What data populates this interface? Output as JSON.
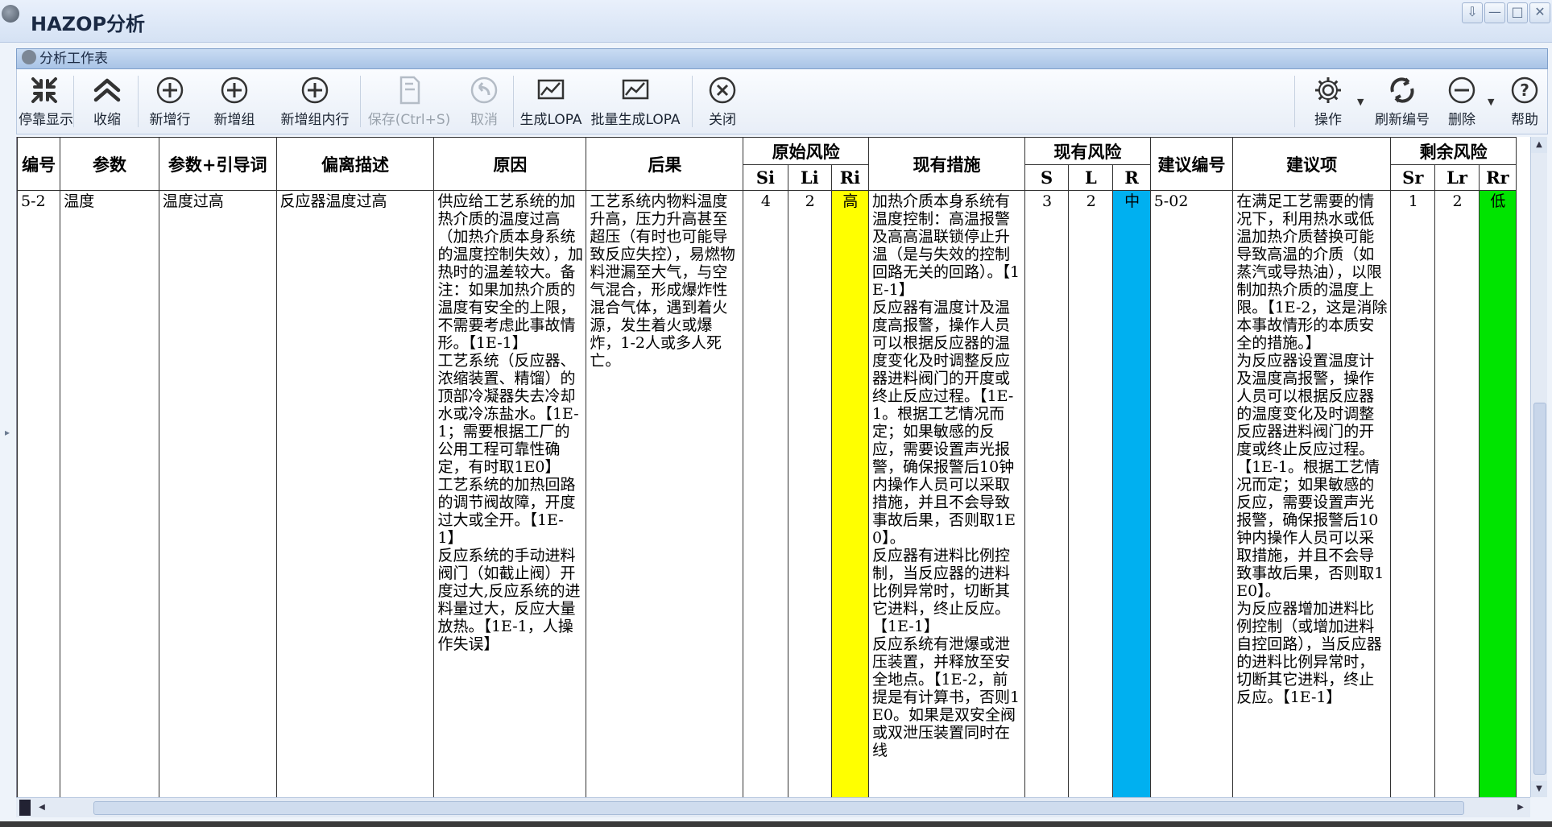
{
  "window": {
    "title": "HAZOP分析",
    "min_label": "—",
    "max_label": "□",
    "close_label": "✕",
    "pin_label": "⇩"
  },
  "panel": {
    "title": "分析工作表"
  },
  "toolbar": {
    "dock": "停靠显示",
    "collapse": "收缩",
    "add_row": "新增行",
    "add_group": "新增组",
    "add_in_group": "新增组内行",
    "save": "保存(Ctrl+S)",
    "cancel": "取消",
    "gen_lopa": "生成LOPA",
    "batch_lopa": "批量生成LOPA",
    "close": "关闭",
    "operate": "操作",
    "renumber": "刷新编号",
    "delete": "删除",
    "help": "帮助"
  },
  "table": {
    "headers": {
      "id": "编号",
      "param": "参数",
      "param_guide": "参数+引导词",
      "deviation": "偏离描述",
      "cause": "原因",
      "consequence": "后果",
      "orig_risk": "原始风险",
      "si": "Si",
      "li": "Li",
      "ri": "Ri",
      "measures": "现有措施",
      "cur_risk": "现有风险",
      "s": "S",
      "l": "L",
      "r": "R",
      "rec_no": "建议编号",
      "recommendation": "建议项",
      "res_risk": "剩余风险",
      "sr": "Sr",
      "lr": "Lr",
      "rr": "Rr"
    },
    "row": {
      "id": "5-2",
      "param": "温度",
      "param_guide": "温度过高",
      "deviation": "反应器温度过高",
      "cause": "供应给工艺系统的加热介质的温度过高（加热介质本身系统的温度控制失效），加热时的温差较大。备注：如果加热介质的温度有安全的上限，不需要考虑此事故情形。【1E-1】\n工艺系统（反应器、浓缩装置、精馏）的顶部冷凝器失去冷却水或冷冻盐水。【1E-1；需要根据工厂的公用工程可靠性确定，有时取1E0】\n工艺系统的加热回路的调节阀故障，开度过大或全开。【1E-1】\n反应系统的手动进料阀门（如截止阀）开度过大,反应系统的进料量过大，反应大量放热。【1E-1，人操作失误】",
      "consequence": "工艺系统内物料温度升高，压力升高甚至超压（有时也可能导致反应失控），易燃物料泄漏至大气，与空气混合，形成爆炸性混合气体，遇到着火源，发生着火或爆炸，1-2人或多人死亡。",
      "si": "4",
      "li": "2",
      "ri": "高",
      "measures": "加热介质本身系统有温度控制：高温报警及高高温联锁停止升温（是与失效的控制回路无关的回路）。【1E-1】\n反应器有温度计及温度高报警，操作人员可以根据反应器的温度变化及时调整反应器进料阀门的开度或终止反应过程。【1E-1。根据工艺情况而定；如果敏感的反应，需要设置声光报警，确保报警后10钟内操作人员可以采取措施，并且不会导致事故后果，否则取1E0】。\n反应器有进料比例控制，当反应器的进料比例异常时，切断其它进料，终止反应。【1E-1】\n反应系统有泄爆或泄压装置，并释放至安全地点。【1E-2，前提是有计算书，否则1E0。如果是双安全阀或双泄压装置同时在线",
      "s": "3",
      "l": "2",
      "r": "中",
      "rec_no": "5-02",
      "recommendation": "在满足工艺需要的情况下，利用热水或低温加热介质替换可能导致高温的介质（如蒸汽或导热油），以限制加热介质的温度上限。【1E-2，这是消除本事故情形的本质安全的措施。】\n为反应器设置温度计及温度高报警，操作人员可以根据反应器的温度变化及时调整反应器进料阀门的开度或终止反应过程。【1E-1。根据工艺情况而定；如果敏感的反应，需要设置声光报警，确保报警后10钟内操作人员可以采取措施，并且不会导致事故后果，否则取1E0】。\n为反应器增加进料比例控制（或增加进料自控回路），当反应器的进料比例异常时，切断其它进料，终止反应。【1E-1】",
      "sr": "1",
      "lr": "2",
      "rr": "低"
    }
  },
  "colors": {
    "high": "#ffff00",
    "mid": "#00b0f0",
    "low": "#00e400"
  }
}
